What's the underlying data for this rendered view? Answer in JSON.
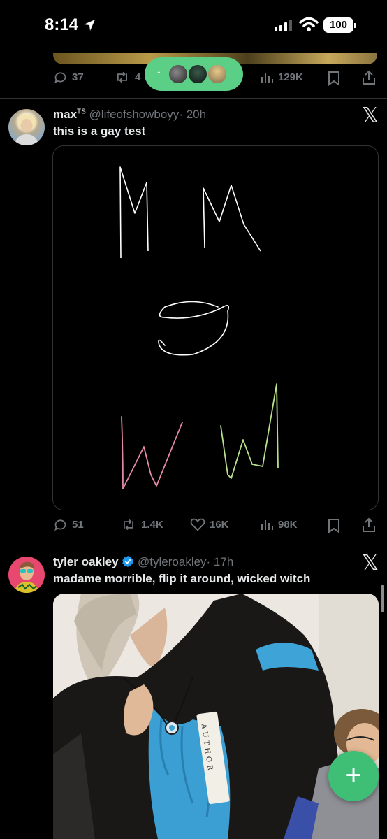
{
  "status_bar": {
    "time": "8:14",
    "battery": "100"
  },
  "post0": {
    "replies": "37",
    "reposts": "4",
    "views": "129K"
  },
  "new_posts_pill": {
    "arrow": "↑"
  },
  "post1": {
    "name": "max",
    "name_suffix": "TS",
    "handle": "@lifeofshowboyy",
    "time": "· 20h",
    "text": "this is a gay test",
    "drawing": {
      "colors": {
        "white": "#ffffff",
        "pink": "#e58aa6",
        "green": "#b8e08a"
      }
    },
    "replies": "51",
    "reposts": "1.4K",
    "likes": "16K",
    "views": "98K"
  },
  "post2": {
    "name": "tyler oakley",
    "handle": "@tyleroakley",
    "time": "· 17h",
    "text": "madame morrible, flip it around, wicked witch",
    "verified_color": "#1d9bf0",
    "sash_text": "AUTHOR"
  },
  "colors": {
    "accent_green": "#5ccf86",
    "fab_green": "#3fbe76",
    "muted": "#71767b"
  }
}
